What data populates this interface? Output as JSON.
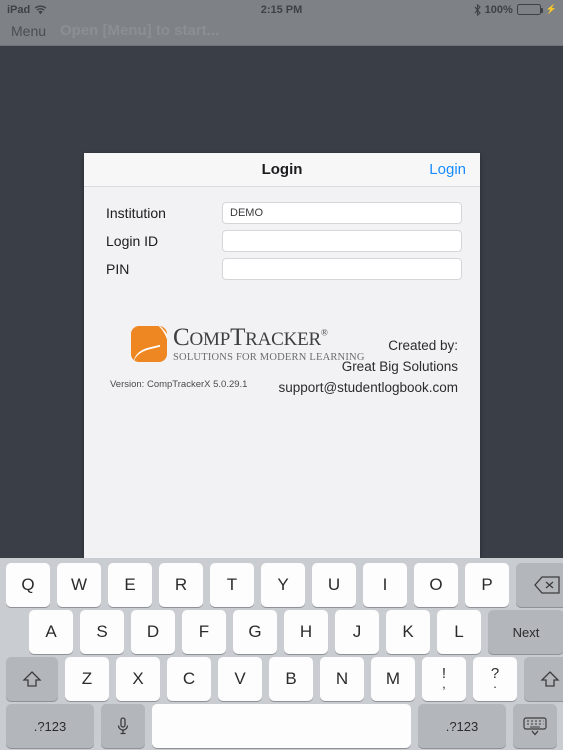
{
  "status_bar": {
    "device": "iPad",
    "wifi_icon": "wifi-icon",
    "time": "2:15 PM",
    "bluetooth_icon": "bluetooth-icon",
    "battery_percent": "100%",
    "battery_icon": "battery-full-charging-icon"
  },
  "nav_bar": {
    "menu_label": "Menu",
    "hint_text": "Open [Menu] to start..."
  },
  "login_card": {
    "title": "Login",
    "action_label": "Login",
    "fields": [
      {
        "label": "Institution",
        "value": "DEMO",
        "placeholder": ""
      },
      {
        "label": "Login ID",
        "value": "",
        "placeholder": ""
      },
      {
        "label": "PIN",
        "value": "",
        "placeholder": ""
      }
    ],
    "branding": {
      "logo_name": "comptracker-logo",
      "logo_word_comp": "C",
      "logo_word_comp_rest": "OMP",
      "logo_word_t": "T",
      "logo_word_tracker_rest": "RACKER",
      "logo_registered": "®",
      "tagline": "SOLUTIONS FOR MODERN LEARNING",
      "version": "Version: CompTrackerX 5.0.29.1",
      "created_by_label": "Created by:",
      "company": "Great Big Solutions",
      "support_email": "support@studentlogbook.com"
    }
  },
  "keyboard": {
    "row1": [
      "Q",
      "W",
      "E",
      "R",
      "T",
      "Y",
      "U",
      "I",
      "O",
      "P"
    ],
    "backspace_icon": "backspace-icon",
    "row2": [
      "A",
      "S",
      "D",
      "F",
      "G",
      "H",
      "J",
      "K",
      "L"
    ],
    "return_label": "Next",
    "row3": [
      "Z",
      "X",
      "C",
      "V",
      "B",
      "N",
      "M"
    ],
    "shift_icon": "shift-icon",
    "punct1_top": "!",
    "punct1_bottom": ",",
    "punct2_top": "?",
    "punct2_bottom": ".",
    "numeric_label": ".?123",
    "mic_icon": "microphone-icon",
    "space_label": "",
    "hide_keyboard_icon": "hide-keyboard-icon"
  },
  "colors": {
    "background": "#3a3e46",
    "status_bar": "#7e8287",
    "card": "#f2f2f4",
    "accent_link": "#1a8cff",
    "logo_orange": "#ee8722",
    "battery_green": "#4cd54c",
    "keyboard_bg": "#c9ccd1"
  }
}
